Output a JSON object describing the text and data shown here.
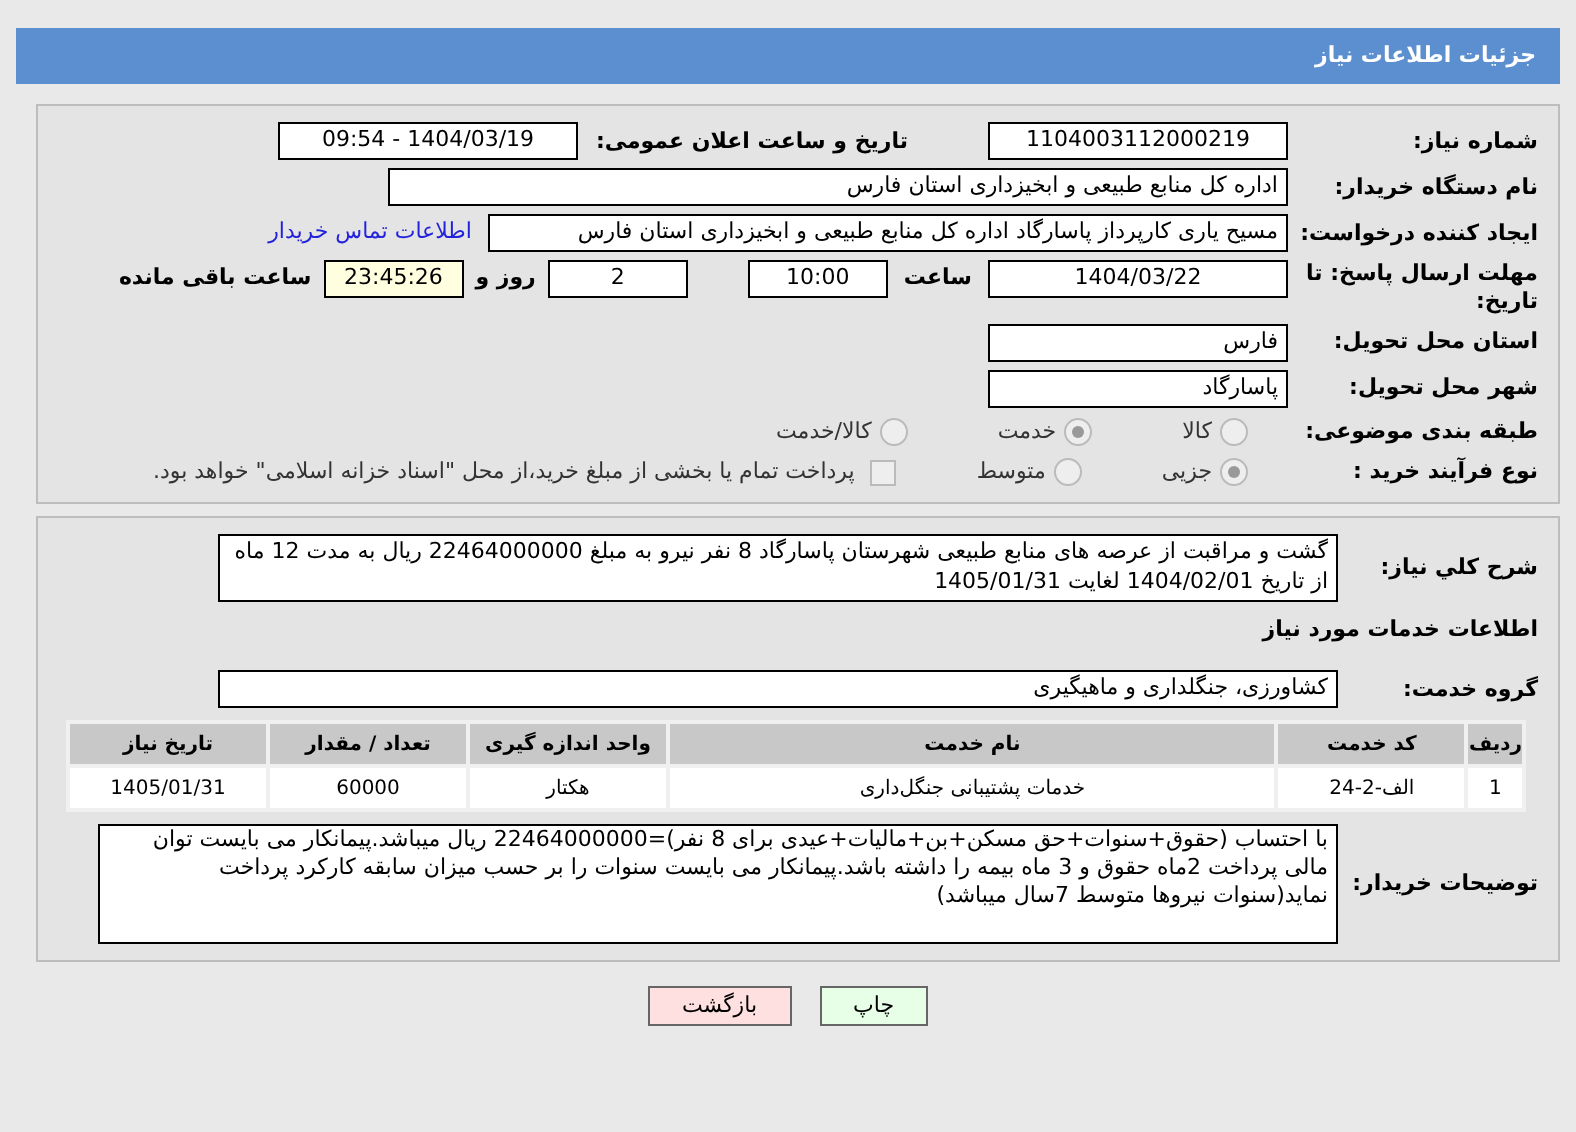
{
  "header": {
    "title": "جزئیات اطلاعات نیاز"
  },
  "need_number": {
    "label": "شماره نیاز:",
    "value": "1104003112000219"
  },
  "announce": {
    "label": "تاریخ و ساعت اعلان عمومی:",
    "value": "1404/03/19 - 09:54"
  },
  "buyer": {
    "label": "نام دستگاه خریدار:",
    "value": "اداره کل منابع طبیعی و ابخیزداری استان فارس"
  },
  "creator": {
    "label": "ایجاد کننده درخواست:",
    "value": "مسیح یاری کارپرداز پاسارگاد اداره کل منابع طبیعی و ابخیزداری استان فارس",
    "link": "اطلاعات تماس خریدار"
  },
  "deadline": {
    "label": "مهلت ارسال پاسخ: تا تاریخ:",
    "date": "1404/03/22",
    "time_label": "ساعت",
    "time": "10:00",
    "days": "2",
    "days_label": "روز و",
    "remaining": "23:45:26",
    "remaining_label": "ساعت باقی مانده"
  },
  "province": {
    "label": "استان محل تحویل:",
    "value": "فارس"
  },
  "city": {
    "label": "شهر محل تحویل:",
    "value": "پاسارگاد"
  },
  "category": {
    "label": "طبقه بندی موضوعی:",
    "options": [
      {
        "label": "کالا",
        "selected": false
      },
      {
        "label": "خدمت",
        "selected": true
      },
      {
        "label": "کالا/خدمت",
        "selected": false
      }
    ]
  },
  "purchase_type": {
    "label": "نوع فرآیند خرید :",
    "options": [
      {
        "label": "جزیی",
        "selected": true
      },
      {
        "label": "متوسط",
        "selected": false
      }
    ],
    "payment": {
      "label": "پرداخت تمام یا بخشی از مبلغ خرید،از محل \"اسناد خزانه اسلامی\" خواهد بود.",
      "checked": false
    }
  },
  "description": {
    "label": "شرح کلي نياز:",
    "value": "گشت و مراقبت از عرصه های منابع طبیعی شهرستان پاسارگاد 8 نفر نیرو  به مبلغ 22464000000 ریال به مدت 12 ماه از تاریخ 1404/02/01 لغایت 1405/01/31"
  },
  "services_title": "اطلاعات خدمات مورد نیاز",
  "service_group": {
    "label": "گروه خدمت:",
    "value": "کشاورزی، جنگلداری و ماهیگیری"
  },
  "table": {
    "columns": [
      "ردیف",
      "کد خدمت",
      "نام خدمت",
      "واحد اندازه گیری",
      "تعداد / مقدار",
      "تاریخ نیاز"
    ],
    "rows": [
      [
        "1",
        "الف-2-24",
        "خدمات پشتیبانی جنگل‌داری",
        "هکتار",
        "60000",
        "1405/01/31"
      ]
    ]
  },
  "buyer_notes": {
    "label": "توضیحات خریدار:",
    "value": "با احتساب (حقوق+سنوات+حق مسکن+بن+مالیات+عیدی برای 8 نفر)=22464000000 ریال میباشد.پیمانکار می بایست توان مالی پرداخت 2ماه حقوق و 3 ماه بیمه را داشته باشد.پیمانکار می بایست سنوات را بر حسب میزان سابقه کارکرد پرداخت نماید(سنوات نیروها متوسط 7سال میباشد)"
  },
  "buttons": [
    {
      "label": "چاپ",
      "kind": "print"
    },
    {
      "label": "بازگشت",
      "kind": "back"
    }
  ]
}
